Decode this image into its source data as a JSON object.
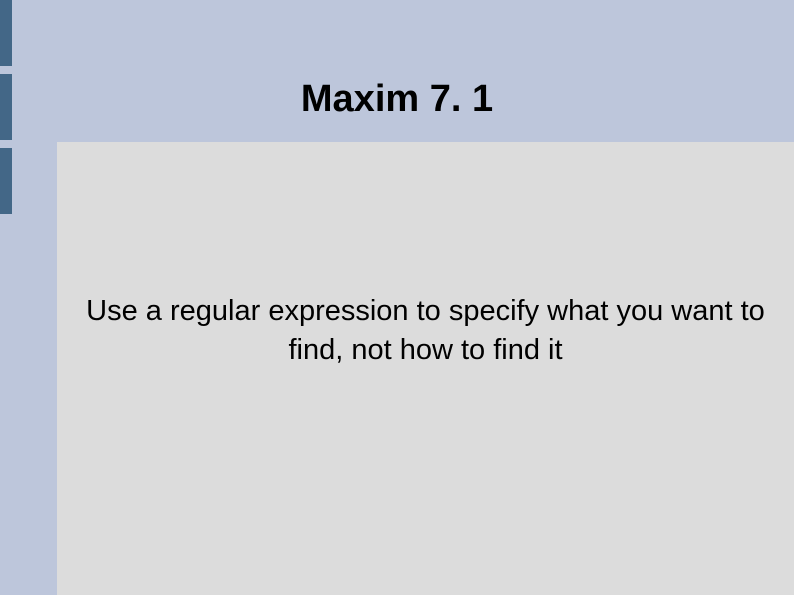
{
  "slide": {
    "title": "Maxim 7. 1",
    "body": "Use a regular expression to specify what you want to find, not how to find it"
  }
}
